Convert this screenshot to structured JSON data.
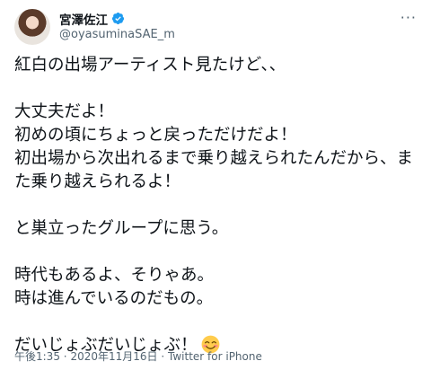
{
  "author": {
    "display_name": "宮澤佐江",
    "handle": "@oyasuminaSAE_m"
  },
  "more_icon": "···",
  "tweet": {
    "lines": [
      "紅白の出場アーティスト見たけど、、",
      "",
      "大丈夫だよ！",
      "初めの頃にちょっと戻っただけだよ！",
      "初出場から次出れるまで乗り越えられたんだから、ま",
      "た乗り越えられるよ！",
      "",
      "と巣立ったグループに思う。",
      "",
      "時代もあるよ、そりゃあ。",
      "時は進んでいるのだもの。",
      "",
      "だいじょぶだいじょぶ！"
    ]
  },
  "meta": {
    "time": "午後1:35",
    "separator": "·",
    "date": "2020年11月16日",
    "source": "Twitter for iPhone"
  },
  "colors": {
    "verified": "#1d9bf0",
    "secondary_text": "#536471"
  }
}
